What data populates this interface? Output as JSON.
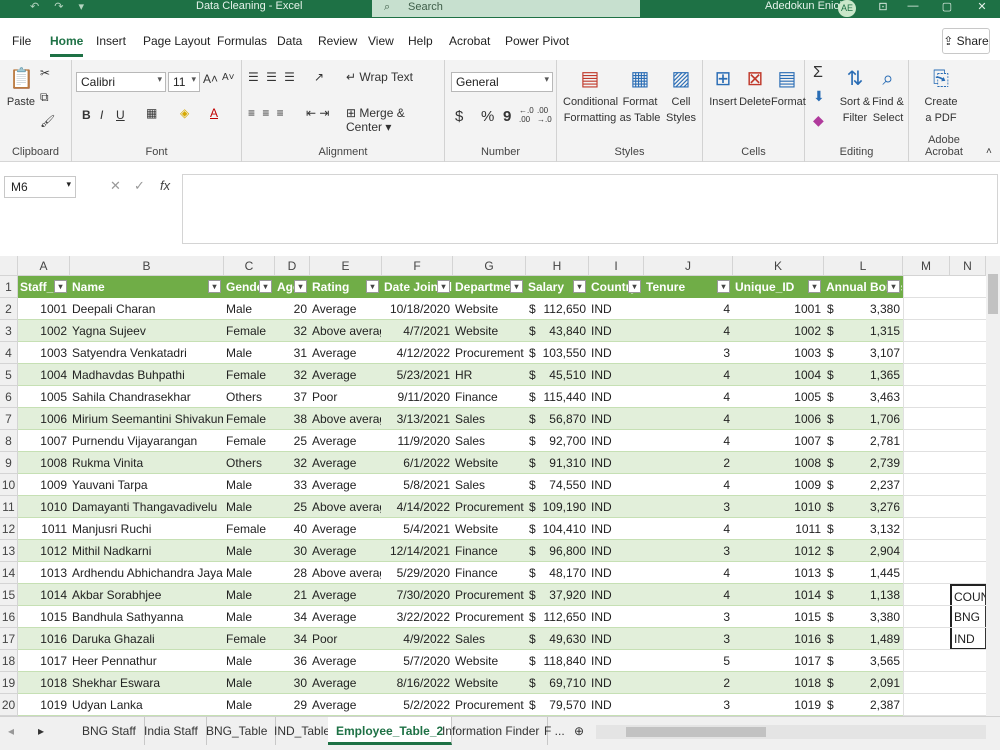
{
  "titlebar": {
    "qat": "↶ ↷ ▾",
    "doc_title": "Data Cleaning  -  Excel",
    "search_placeholder": "Search",
    "user": "Adedokun Eniola",
    "initials": "AE",
    "win_btns": [
      "⊡",
      "—",
      "▢",
      "✕"
    ]
  },
  "menu": {
    "tabs": [
      "File",
      "Home",
      "Insert",
      "Page Layout",
      "Formulas",
      "Data",
      "Review",
      "View",
      "Help",
      "Acrobat",
      "Power Pivot"
    ],
    "active": "Home",
    "share": "Share"
  },
  "ribbon": {
    "clipboard": {
      "label": "Clipboard",
      "paste": "Paste"
    },
    "font": {
      "label": "Font",
      "name": "Calibri",
      "size": "11",
      "grow": "A˄",
      "shrink": "A˅",
      "bold": "B",
      "italic": "I",
      "underline": "U",
      "font_color": "A",
      "fill_color": "◈"
    },
    "alignment": {
      "label": "Alignment",
      "wrap": "Wrap Text",
      "merge": "Merge & Center"
    },
    "number": {
      "label": "Number",
      "format": "General",
      "currency": "$",
      "percent": "%",
      "comma": "9",
      "inc_dec": "←.0 .00",
      "dec_dec": ".00 →.0"
    },
    "styles": {
      "label": "Styles",
      "cond": "Conditional Formatting",
      "table": "Format as Table",
      "cell": "Cell Styles"
    },
    "cells": {
      "label": "Cells",
      "insert": "Insert",
      "delete": "Delete",
      "format": "Format"
    },
    "editing": {
      "label": "Editing",
      "sort": "Sort & Filter",
      "find": "Find & Select"
    },
    "acrobat": {
      "label": "Adobe Acrobat",
      "create": "Create a PDF"
    }
  },
  "formula": {
    "namebox": "M6",
    "value": "",
    "cancel": "✕",
    "enter": "✓",
    "fx": "fx"
  },
  "columns": [
    "A",
    "B",
    "C",
    "D",
    "E",
    "F",
    "G",
    "H",
    "I",
    "J",
    "K",
    "L",
    "M",
    "N"
  ],
  "headers": [
    "Staff_Id",
    "Name",
    "Gender",
    "Age",
    "Rating",
    "Date Joined",
    "Department",
    "Salary",
    "Country",
    "Tenure",
    "Unique_ID",
    "Annual Bonus"
  ],
  "rows": [
    {
      "n": "2",
      "id": "1001",
      "name": "Deepali Charan",
      "gender": "Male",
      "age": "20",
      "rating": "Average",
      "date": "10/18/2020",
      "dept": "Website",
      "salary": "112,650",
      "country": "IND",
      "tenure": "4",
      "uid": "1001",
      "bonus": "3,380"
    },
    {
      "n": "3",
      "id": "1002",
      "name": "Yagna Sujeev",
      "gender": "Female",
      "age": "32",
      "rating": "Above average",
      "date": "4/7/2021",
      "dept": "Website",
      "salary": "43,840",
      "country": "IND",
      "tenure": "4",
      "uid": "1002",
      "bonus": "1,315"
    },
    {
      "n": "4",
      "id": "1003",
      "name": "Satyendra Venkatadri",
      "gender": "Male",
      "age": "31",
      "rating": "Average",
      "date": "4/12/2022",
      "dept": "Procurement",
      "salary": "103,550",
      "country": "IND",
      "tenure": "3",
      "uid": "1003",
      "bonus": "3,107"
    },
    {
      "n": "5",
      "id": "1004",
      "name": "Madhavdas Buhpathi",
      "gender": "Female",
      "age": "32",
      "rating": "Average",
      "date": "5/23/2021",
      "dept": "HR",
      "salary": "45,510",
      "country": "IND",
      "tenure": "4",
      "uid": "1004",
      "bonus": "1,365"
    },
    {
      "n": "6",
      "id": "1005",
      "name": "Sahila Chandrasekhar",
      "gender": "Others",
      "age": "37",
      "rating": "Poor",
      "date": "9/11/2020",
      "dept": "Finance",
      "salary": "115,440",
      "country": "IND",
      "tenure": "4",
      "uid": "1005",
      "bonus": "3,463"
    },
    {
      "n": "7",
      "id": "1006",
      "name": "Mirium Seemantini Shivakumar",
      "gender": "Female",
      "age": "38",
      "rating": "Above average",
      "date": "3/13/2021",
      "dept": "Sales",
      "salary": "56,870",
      "country": "IND",
      "tenure": "4",
      "uid": "1006",
      "bonus": "1,706"
    },
    {
      "n": "8",
      "id": "1007",
      "name": "Purnendu Vijayarangan",
      "gender": "Female",
      "age": "25",
      "rating": "Average",
      "date": "11/9/2020",
      "dept": "Sales",
      "salary": "92,700",
      "country": "IND",
      "tenure": "4",
      "uid": "1007",
      "bonus": "2,781"
    },
    {
      "n": "9",
      "id": "1008",
      "name": "Rukma Vinita",
      "gender": "Others",
      "age": "32",
      "rating": "Average",
      "date": "6/1/2022",
      "dept": "Website",
      "salary": "91,310",
      "country": "IND",
      "tenure": "2",
      "uid": "1008",
      "bonus": "2,739"
    },
    {
      "n": "10",
      "id": "1009",
      "name": "Yauvani Tarpa",
      "gender": "Male",
      "age": "33",
      "rating": "Average",
      "date": "5/8/2021",
      "dept": "Sales",
      "salary": "74,550",
      "country": "IND",
      "tenure": "4",
      "uid": "1009",
      "bonus": "2,237"
    },
    {
      "n": "11",
      "id": "1010",
      "name": "Damayanti Thangavadivelu",
      "gender": "Male",
      "age": "25",
      "rating": "Above average",
      "date": "4/14/2022",
      "dept": "Procurement",
      "salary": "109,190",
      "country": "IND",
      "tenure": "3",
      "uid": "1010",
      "bonus": "3,276"
    },
    {
      "n": "12",
      "id": "1011",
      "name": "Manjusri Ruchi",
      "gender": "Female",
      "age": "40",
      "rating": "Average",
      "date": "5/4/2021",
      "dept": "Website",
      "salary": "104,410",
      "country": "IND",
      "tenure": "4",
      "uid": "1011",
      "bonus": "3,132"
    },
    {
      "n": "13",
      "id": "1012",
      "name": "Mithil Nadkarni",
      "gender": "Male",
      "age": "30",
      "rating": "Average",
      "date": "12/14/2021",
      "dept": "Finance",
      "salary": "96,800",
      "country": "IND",
      "tenure": "3",
      "uid": "1012",
      "bonus": "2,904"
    },
    {
      "n": "14",
      "id": "1013",
      "name": "Ardhendu Abhichandra Jayakar",
      "gender": "Male",
      "age": "28",
      "rating": "Above average",
      "date": "5/29/2020",
      "dept": "Finance",
      "salary": "48,170",
      "country": "IND",
      "tenure": "4",
      "uid": "1013",
      "bonus": "1,445"
    },
    {
      "n": "15",
      "id": "1014",
      "name": "Akbar Sorabhjee",
      "gender": "Male",
      "age": "21",
      "rating": "Average",
      "date": "7/30/2020",
      "dept": "Procurement",
      "salary": "37,920",
      "country": "IND",
      "tenure": "4",
      "uid": "1014",
      "bonus": "1,138"
    },
    {
      "n": "16",
      "id": "1015",
      "name": "Bandhula Sathyanna",
      "gender": "Male",
      "age": "34",
      "rating": "Average",
      "date": "3/22/2022",
      "dept": "Procurement",
      "salary": "112,650",
      "country": "IND",
      "tenure": "3",
      "uid": "1015",
      "bonus": "3,380"
    },
    {
      "n": "17",
      "id": "1016",
      "name": "Daruka Ghazali",
      "gender": "Female",
      "age": "34",
      "rating": "Poor",
      "date": "4/9/2022",
      "dept": "Sales",
      "salary": "49,630",
      "country": "IND",
      "tenure": "3",
      "uid": "1016",
      "bonus": "1,489"
    },
    {
      "n": "18",
      "id": "1017",
      "name": "Heer Pennathur",
      "gender": "Male",
      "age": "36",
      "rating": "Average",
      "date": "5/7/2020",
      "dept": "Website",
      "salary": "118,840",
      "country": "IND",
      "tenure": "5",
      "uid": "1017",
      "bonus": "3,565"
    },
    {
      "n": "19",
      "id": "1018",
      "name": "Shekhar Eswara",
      "gender": "Male",
      "age": "30",
      "rating": "Average",
      "date": "8/16/2022",
      "dept": "Website",
      "salary": "69,710",
      "country": "IND",
      "tenure": "2",
      "uid": "1018",
      "bonus": "2,091"
    },
    {
      "n": "20",
      "id": "1019",
      "name": "Udyan Lanka",
      "gender": "Male",
      "age": "29",
      "rating": "Average",
      "date": "5/2/2022",
      "dept": "Procurement",
      "salary": "79,570",
      "country": "IND",
      "tenure": "3",
      "uid": "1019",
      "bonus": "2,387"
    }
  ],
  "currency_symbol": "$",
  "side_box": [
    "COUNT",
    "BNG",
    "IND"
  ],
  "sheet_tabs": [
    "BNG Staff",
    "India Staff",
    "BNG_Table",
    "IND_Table",
    "Employee_Table_2",
    "Information Finder",
    "F ..."
  ],
  "active_sheet": "Employee_Table_2",
  "colors": {
    "accent": "#1e7145",
    "header_fill": "#70ad47",
    "band_fill": "#e2efda"
  }
}
